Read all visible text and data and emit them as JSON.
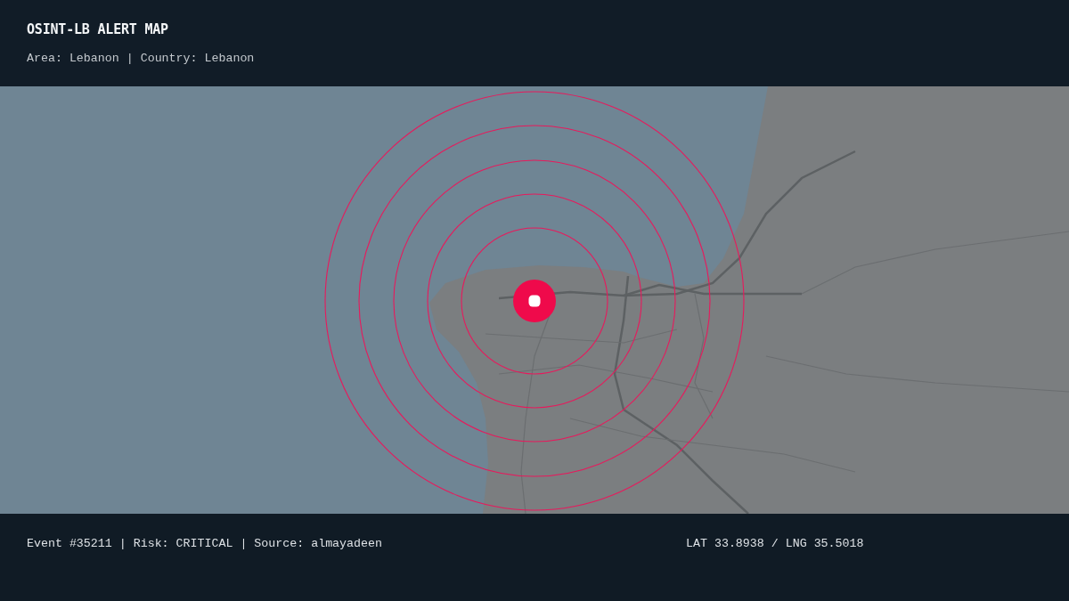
{
  "header": {
    "title": "OSINT-LB ALERT MAP",
    "subtitle": "Area: Lebanon | Country: Lebanon"
  },
  "footer": {
    "event": "Event #35211 | Risk: CRITICAL | Source: almayadeen",
    "coordinates": "LAT 33.8938 / LNG 35.5018"
  }
}
